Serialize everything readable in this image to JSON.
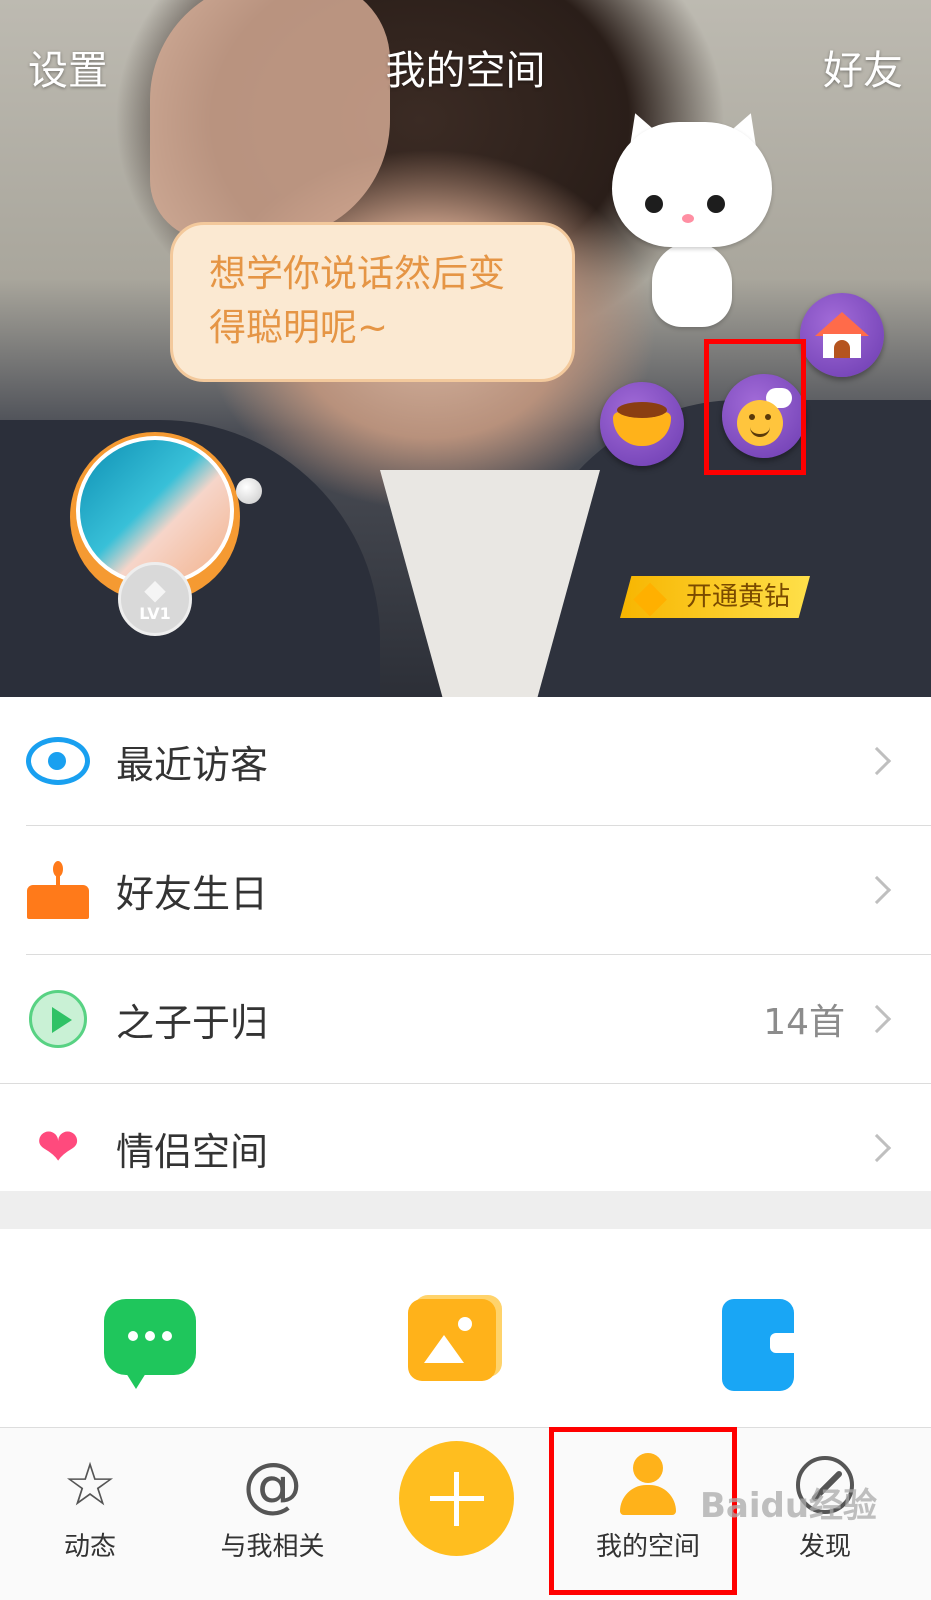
{
  "header": {
    "left_label": "设置",
    "title": "我的空间",
    "right_label": "好友"
  },
  "cover": {
    "pet_speech": "想学你说话然后变得聪明呢~",
    "level_badge": "LV1",
    "vip_label": "开通黄钻",
    "icons": {
      "house": "house-icon",
      "chat": "chat-smile-icon",
      "food": "food-bowl-icon"
    }
  },
  "menu": {
    "items": [
      {
        "label": "最近访客",
        "icon": "eye-icon",
        "extra": ""
      },
      {
        "label": "好友生日",
        "icon": "birthday-cake-icon",
        "extra": ""
      },
      {
        "label": "之子于归",
        "icon": "play-icon",
        "extra": "14首"
      },
      {
        "label": "情侣空间",
        "icon": "hearts-icon",
        "extra": ""
      }
    ]
  },
  "shortcuts": [
    {
      "icon": "message-icon"
    },
    {
      "icon": "photo-album-icon"
    },
    {
      "icon": "wallet-icon"
    }
  ],
  "tabbar": {
    "tabs": [
      {
        "label": "动态",
        "icon": "star-icon"
      },
      {
        "label": "与我相关",
        "icon": "at-icon"
      },
      {
        "label": "我的空间",
        "icon": "person-icon",
        "active": true
      },
      {
        "label": "发现",
        "icon": "compass-icon"
      }
    ],
    "add_button": "plus-icon"
  },
  "colors": {
    "accent": "#ffbe1f",
    "highlight_box": "#ff0000",
    "speech_text": "#e59545"
  },
  "watermark": "Baidu经验"
}
